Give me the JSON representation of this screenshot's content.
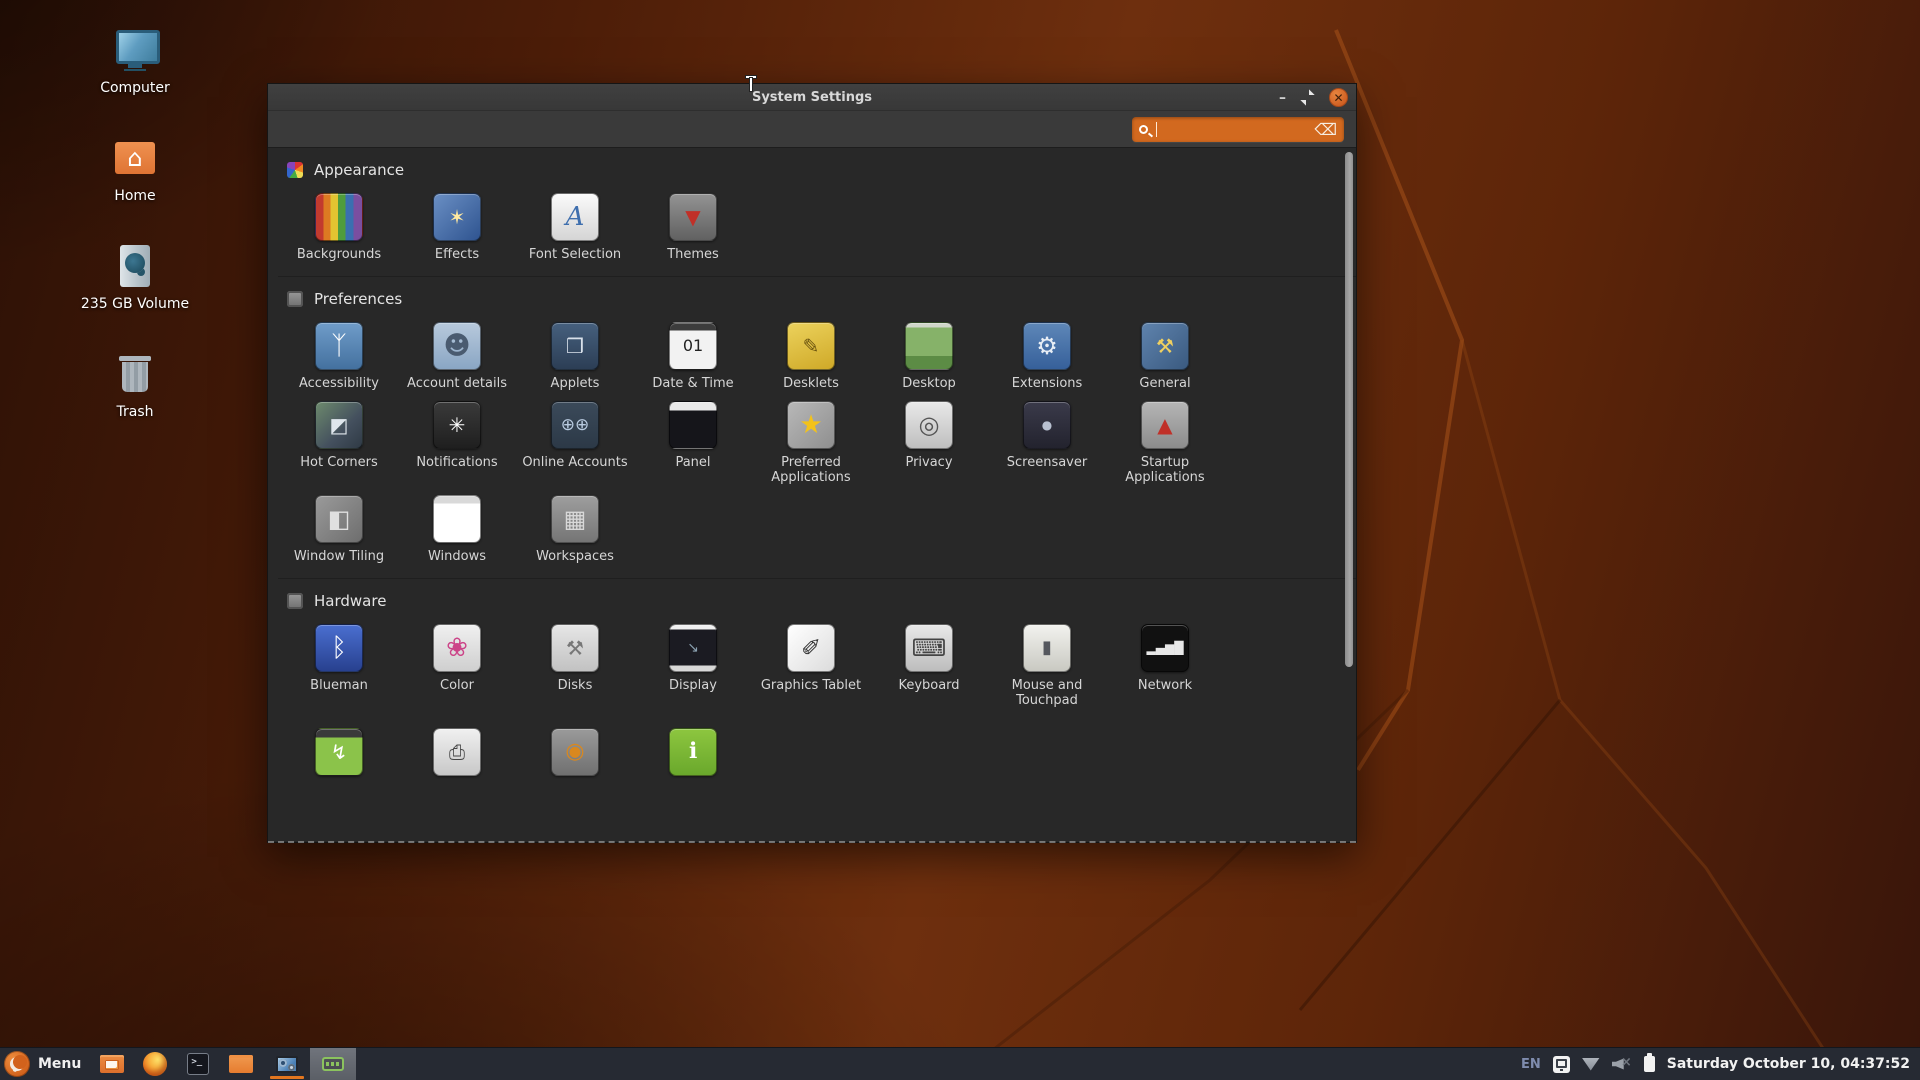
{
  "colors": {
    "accent_orange": "#d2691f",
    "desktop_base": "#5a2309",
    "wall_line": "#b65c1d",
    "titlebar_bg": "#3a3a3a",
    "window_bg": "#282828",
    "panel_bg": "#262a33",
    "close_button": "#cf5f22",
    "active_task_bg": "#6b6f76"
  },
  "desktop": {
    "icons": [
      {
        "label": "Computer",
        "icon": "computer-icon"
      },
      {
        "label": "Home",
        "icon": "home-icon"
      },
      {
        "label": "235 GB Volume",
        "icon": "volume-icon"
      },
      {
        "label": "Trash",
        "icon": "trash-icon"
      }
    ]
  },
  "window": {
    "title": "System Settings",
    "controls": {
      "minimize_glyph": "–",
      "close_glyph": "✕"
    },
    "search": {
      "value": "",
      "placeholder": "",
      "clear_glyph": "⌫"
    },
    "sections": [
      {
        "label": "Appearance",
        "tiles": [
          {
            "label": "Backgrounds",
            "icon": "backgrounds-icon",
            "bg": "linear-gradient(90deg,#c23a2e 0%,#c23a2e 16%,#dd7a22 16%,#dd7a22 32%,#e2c431 32%,#e2c431 48%,#4f9c3c 48%,#4f9c3c 64%,#3a6fb0 64%,#3a6fb0 82%,#7a4ea0 82%)",
            "glyph": "",
            "glyph_color": "#ffffff"
          },
          {
            "label": "Effects",
            "icon": "effects-icon",
            "bg": "linear-gradient(135deg,#6a8fc4,#2f5490)",
            "glyph": "✶",
            "glyph_color": "#ffe9a0"
          },
          {
            "label": "Font Selection",
            "icon": "font-selection-icon",
            "bg": "linear-gradient(180deg,#fafafa,#d5d5d5)",
            "glyph": "A",
            "glyph_color": "#3f6fae",
            "glyph_size": 26,
            "italic": true
          },
          {
            "label": "Themes",
            "icon": "themes-icon",
            "bg": "linear-gradient(180deg,#939393,#616161)",
            "glyph": "▼",
            "glyph_color": "#c03028"
          }
        ]
      },
      {
        "label": "Preferences",
        "tiles": [
          {
            "label": "Accessibility",
            "icon": "accessibility-icon",
            "bg": "linear-gradient(180deg,#6f9cc9,#44719f)",
            "glyph": "ᛉ",
            "glyph_color": "#ffffff",
            "glyph_size": 26
          },
          {
            "label": "Account details",
            "icon": "account-details-icon",
            "bg": "linear-gradient(180deg,#b7c9dc,#8aa6c4)",
            "glyph": "☻",
            "glyph_color": "#4a5b70",
            "glyph_size": 26
          },
          {
            "label": "Applets",
            "icon": "applets-icon",
            "bg": "linear-gradient(180deg,#46607e,#2c3e55)",
            "glyph": "❒",
            "glyph_color": "#d8e0ea"
          },
          {
            "label": "Date & Time",
            "icon": "date-time-icon",
            "bg": "linear-gradient(180deg,#3c3c3c 0%,#3c3c3c 16%,#f2f2f2 16%)",
            "glyph": "01",
            "glyph_color": "#222222",
            "glyph_size": 16
          },
          {
            "label": "Desklets",
            "icon": "desklets-icon",
            "bg": "linear-gradient(160deg,#ecd25c,#cfa928)",
            "glyph": "✎",
            "glyph_color": "#6b5410"
          },
          {
            "label": "Desktop",
            "icon": "desktop-settings-icon",
            "bg": "linear-gradient(180deg,#cfd6c8 0%,#cfd6c8 10%,#86b269 10%,#86b269 72%,#5c8c45 72%)",
            "glyph": "",
            "glyph_color": "#ffffff"
          },
          {
            "label": "Extensions",
            "icon": "extensions-icon",
            "bg": "linear-gradient(180deg,#5e87b8,#36609a)",
            "glyph": "⚙",
            "glyph_color": "#e8eef5",
            "glyph_size": 24
          },
          {
            "label": "General",
            "icon": "general-icon",
            "bg": "linear-gradient(135deg,#5f83ad,#3a5a80)",
            "glyph": "⚒",
            "glyph_color": "#f0d060"
          },
          {
            "label": "Hot Corners",
            "icon": "hot-corners-icon",
            "bg": "linear-gradient(135deg,#6d8a6d 0%,#44505e 60%,#2f3a45 100%)",
            "glyph": "◩",
            "glyph_color": "#dfe6ec"
          },
          {
            "label": "Notifications",
            "icon": "notifications-icon",
            "bg": "linear-gradient(180deg,#3a3a3a,#1f1f1f)",
            "glyph": "✳",
            "glyph_color": "#ffffff"
          },
          {
            "label": "Online Accounts",
            "icon": "online-accounts-icon",
            "bg": "linear-gradient(180deg,#3b4a5a,#2c3947)",
            "glyph": "⊕⊕",
            "glyph_color": "#b9cbe0",
            "glyph_size": 17
          },
          {
            "label": "Panel",
            "icon": "panel-icon",
            "bg": "linear-gradient(180deg,#e8e8e8 0%,#e8e8e8 18%,#15151a 18%)",
            "glyph": "",
            "glyph_color": "#ffffff"
          },
          {
            "label": "Preferred Applications",
            "icon": "preferred-applications-icon",
            "bg": "linear-gradient(135deg,#b8b8b8,#8f8f8f)",
            "glyph": "★",
            "glyph_color": "#f3c21a",
            "glyph_size": 26
          },
          {
            "label": "Privacy",
            "icon": "privacy-icon",
            "bg": "linear-gradient(180deg,#e8e8e8,#bfbfbf)",
            "glyph": "◎",
            "glyph_color": "#555555",
            "glyph_size": 24
          },
          {
            "label": "Screensaver",
            "icon": "screensaver-icon",
            "bg": "linear-gradient(180deg,#3a3a4a,#23232e)",
            "glyph": "●",
            "glyph_color": "#b8c0d0",
            "glyph_size": 12
          },
          {
            "label": "Startup Applications",
            "icon": "startup-applications-icon",
            "bg": "linear-gradient(180deg,#b5b5b5,#8c8c8c)",
            "glyph": "▲",
            "glyph_color": "#c03028"
          },
          {
            "label": "Window Tiling",
            "icon": "window-tiling-icon",
            "bg": "linear-gradient(135deg,#9a9a9a,#6e6e6e)",
            "glyph": "◧",
            "glyph_color": "#e0e0e0",
            "glyph_size": 24
          },
          {
            "label": "Windows",
            "icon": "windows-icon",
            "bg": "linear-gradient(180deg,#d9d9d9 0%,#d9d9d9 16%,#ffffff 16%)",
            "glyph": "",
            "glyph_color": "#ffffff"
          },
          {
            "label": "Workspaces",
            "icon": "workspaces-icon",
            "bg": "linear-gradient(180deg,#9e9e9e,#757575)",
            "glyph": "▦",
            "glyph_color": "#d8d8d8",
            "glyph_size": 24
          }
        ]
      },
      {
        "label": "Hardware",
        "tiles": [
          {
            "label": "Blueman",
            "icon": "blueman-icon",
            "bg": "linear-gradient(180deg,#4a6fd0,#28418f)",
            "glyph": "ᛒ",
            "glyph_color": "#ffffff",
            "glyph_size": 26
          },
          {
            "label": "Color",
            "icon": "color-icon",
            "bg": "linear-gradient(180deg,#f0f0f0,#cfcfcf)",
            "glyph": "❀",
            "glyph_color": "#cc4488",
            "glyph_size": 26
          },
          {
            "label": "Disks",
            "icon": "disks-icon",
            "bg": "linear-gradient(180deg,#e6e6e6,#c2c2c2)",
            "glyph": "⚒",
            "glyph_color": "#777777"
          },
          {
            "label": "Display",
            "icon": "display-icon",
            "bg": "linear-gradient(180deg,#f0f0f0 0%,#f0f0f0 10%,#1b1b22 10%,#1b1b22 88%,#d8d8d8 88%)",
            "glyph": "↘",
            "glyph_color": "#8aa0b0",
            "glyph_size": 14
          },
          {
            "label": "Graphics Tablet",
            "icon": "graphics-tablet-icon",
            "bg": "linear-gradient(135deg,#ffffff,#dcdcdc)",
            "glyph": "✐",
            "glyph_color": "#333333",
            "glyph_size": 24
          },
          {
            "label": "Keyboard",
            "icon": "keyboard-icon",
            "bg": "linear-gradient(180deg,#e8e8e8,#bdbdbd)",
            "glyph": "⌨",
            "glyph_color": "#444444",
            "glyph_size": 24
          },
          {
            "label": "Mouse and Touchpad",
            "icon": "mouse-touchpad-icon",
            "bg": "linear-gradient(180deg,#f2f2ee,#c9c9c2)",
            "glyph": "▮",
            "glyph_color": "#55585e",
            "glyph_size": 18
          },
          {
            "label": "Network",
            "icon": "network-icon",
            "bg": "#111111",
            "glyph": "▂▄▆█",
            "glyph_color": "#e8e8e8",
            "glyph_size": 12
          }
        ],
        "partial_tiles": [
          {
            "icon": "power-management-icon",
            "bg": "linear-gradient(180deg,#3a3a3a 0%,#3a3a3a 18%,#8bc34a 18%)",
            "glyph": "↯",
            "glyph_color": "#ffffff"
          },
          {
            "icon": "printers-icon",
            "bg": "linear-gradient(180deg,#f0f0f0,#c8c8c8)",
            "glyph": "⎙",
            "glyph_color": "#444444"
          },
          {
            "icon": "sound-icon",
            "bg": "linear-gradient(180deg,#9a9a9a,#707070)",
            "glyph": "◉",
            "glyph_color": "#d9881e",
            "glyph_size": 22
          },
          {
            "icon": "system-info-icon",
            "bg": "linear-gradient(180deg,#8dc63f,#6aa82c)",
            "glyph": "ℹ",
            "glyph_color": "#ffffff",
            "glyph_size": 22
          }
        ]
      }
    ]
  },
  "taskbar": {
    "menu_label": "Menu",
    "launchers": [
      {
        "icon": "show-desktop-icon"
      },
      {
        "icon": "firefox-icon"
      },
      {
        "icon": "terminal-icon"
      },
      {
        "icon": "files-icon"
      }
    ],
    "window_buttons": [
      {
        "icon": "media-tool-window-icon",
        "active": false
      },
      {
        "icon": "system-settings-window-icon",
        "active": true
      }
    ],
    "tray": {
      "layout_label": "EN",
      "icons": [
        "screenshot-icon",
        "wifi-icon",
        "volume-muted-icon",
        "battery-icon"
      ],
      "clock": "Saturday October 10, 04:37:52"
    }
  }
}
